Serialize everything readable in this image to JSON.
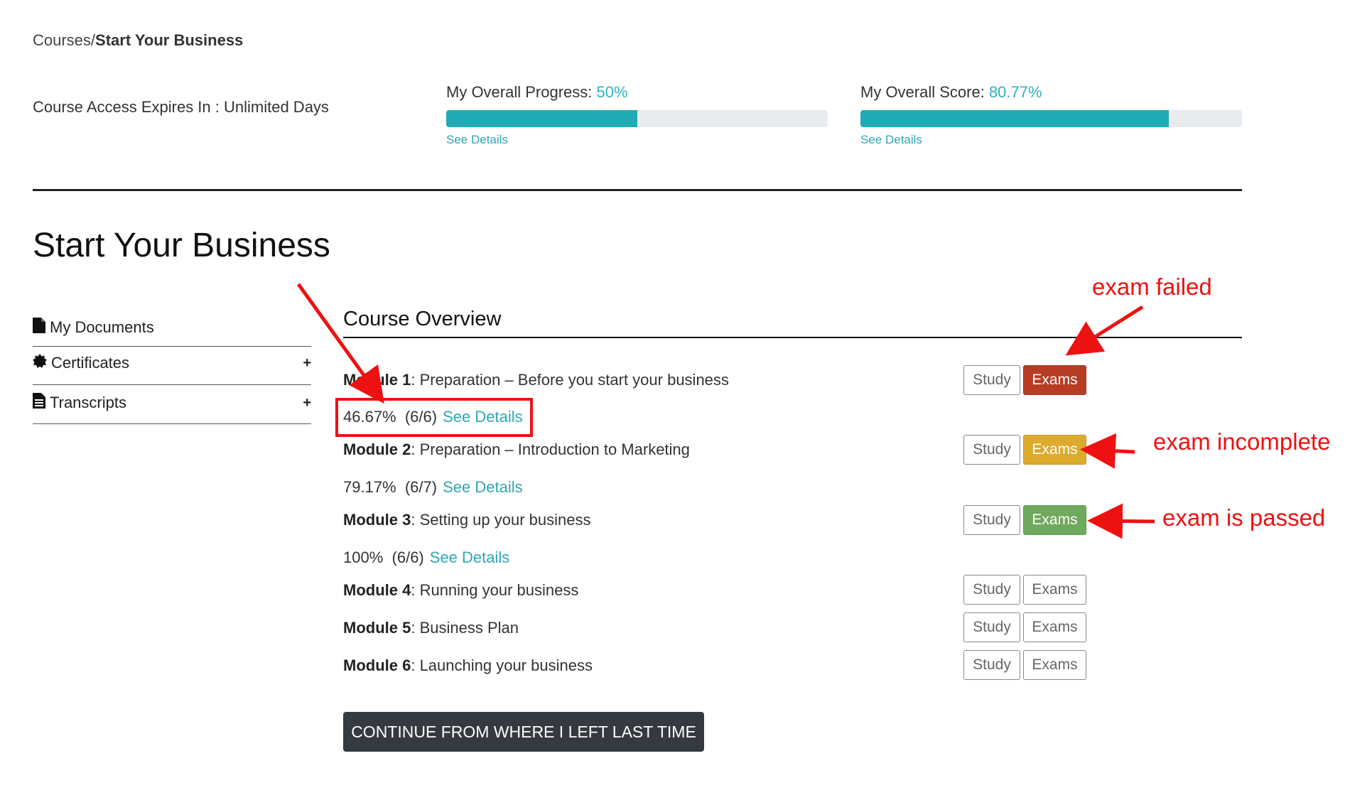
{
  "breadcrumb": {
    "parent": "Courses",
    "separator": "/",
    "current": "Start Your Business"
  },
  "access": {
    "text": "Course Access Expires In : Unlimited Days"
  },
  "progress": {
    "label": "My Overall Progress: ",
    "value_text": "50%",
    "value": 50,
    "details": "See Details"
  },
  "score": {
    "label": "My Overall Score: ",
    "value_text": "80.77%",
    "value": 80.77,
    "details": "See Details"
  },
  "page_title": "Start Your Business",
  "sidebar": {
    "items": [
      {
        "label": "My Documents",
        "icon": "document-icon",
        "expand": ""
      },
      {
        "label": "Certificates",
        "icon": "badge-icon",
        "expand": "+"
      },
      {
        "label": "Transcripts",
        "icon": "transcript-icon",
        "expand": "+"
      }
    ]
  },
  "overview": {
    "title": "Course Overview",
    "modules": [
      {
        "num": "Module 1",
        "title": ": Preparation – Before you start your business",
        "stat_pct": "46.67%",
        "stat_count": "(6/6)",
        "details": "See Details",
        "study": "Study",
        "exams": "Exams",
        "exam_status": "failed"
      },
      {
        "num": "Module 2",
        "title": ": Preparation – Introduction to Marketing",
        "stat_pct": "79.17%",
        "stat_count": "(6/7)",
        "details": "See Details",
        "study": "Study",
        "exams": "Exams",
        "exam_status": "incomplete"
      },
      {
        "num": "Module 3",
        "title": ": Setting up your business",
        "stat_pct": "100%",
        "stat_count": "(6/6)",
        "details": "See Details",
        "study": "Study",
        "exams": "Exams",
        "exam_status": "passed"
      },
      {
        "num": "Module 4",
        "title": ": Running your business",
        "study": "Study",
        "exams": "Exams",
        "exam_status": "none"
      },
      {
        "num": "Module 5",
        "title": ": Business Plan",
        "study": "Study",
        "exams": "Exams",
        "exam_status": "none"
      },
      {
        "num": "Module 6",
        "title": ": Launching your business",
        "study": "Study",
        "exams": "Exams",
        "exam_status": "none"
      }
    ]
  },
  "continue_label": "CONTINUE FROM WHERE I LEFT LAST TIME",
  "annotations": {
    "failed": "exam failed",
    "incomplete": "exam incomplete",
    "passed": "exam is passed"
  },
  "colors": {
    "accent": "#20aab4",
    "failed": "#b83b24",
    "incomplete": "#dcab2b",
    "passed": "#6fa95d",
    "annotation": "#ee1111"
  }
}
